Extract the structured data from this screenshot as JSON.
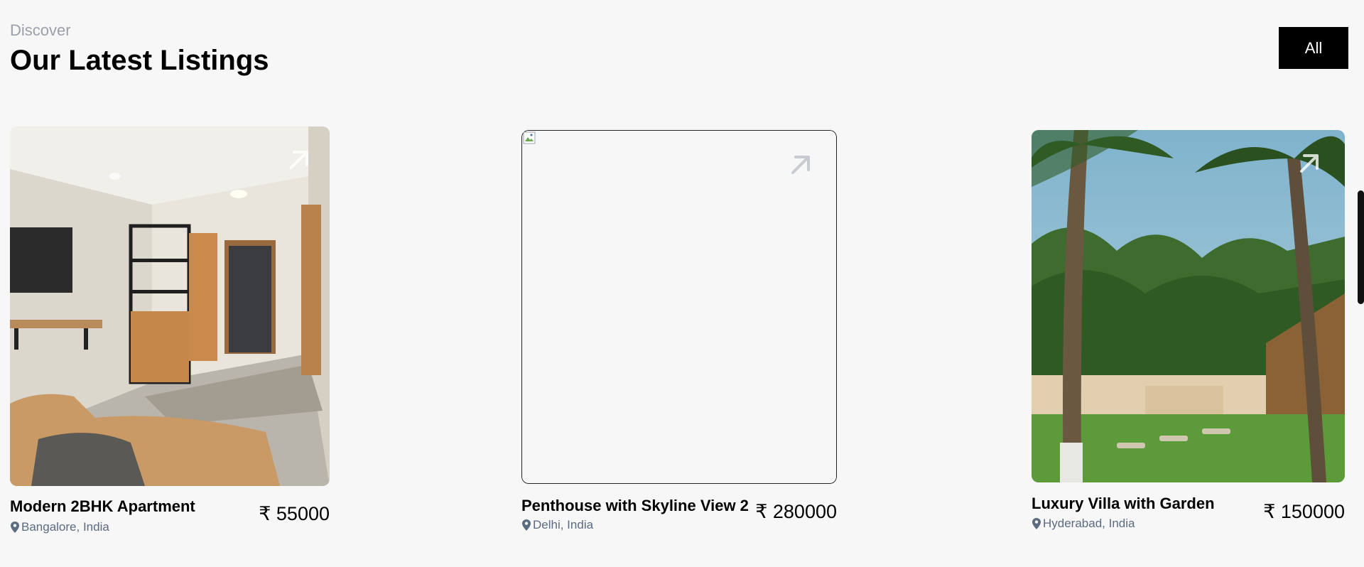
{
  "header": {
    "eyebrow": "Discover",
    "title": "Our Latest Listings",
    "filter_button": "All"
  },
  "listings": [
    {
      "title": "Modern 2BHK Apartment",
      "location": "Bangalore, India",
      "price": "₹ 55000",
      "image": "apartment-interior-photo"
    },
    {
      "title": "Penthouse with Skyline View 2",
      "location": "Delhi, India",
      "price": "₹ 280000",
      "image": "broken-image"
    },
    {
      "title": "Luxury Villa with Garden",
      "location": "Hyderabad, India",
      "price": "₹ 150000",
      "image": "palm-garden-villa-photo"
    }
  ],
  "colors": {
    "background": "#f7f7f7",
    "button_bg": "#000000",
    "location_text": "#5b6b80",
    "eyebrow_text": "#9a9fa8"
  }
}
